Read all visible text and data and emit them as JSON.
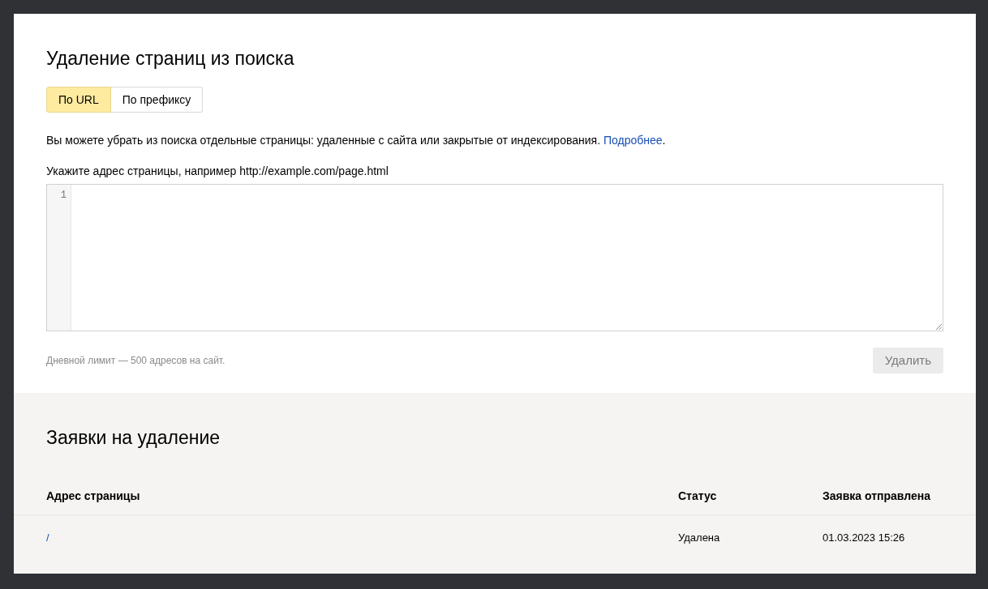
{
  "title": "Удаление страниц из поиска",
  "tabs": [
    {
      "label": "По URL",
      "selected": true
    },
    {
      "label": "По префиксу",
      "selected": false
    }
  ],
  "description": {
    "text": "Вы можете убрать из поиска отдельные страницы: удаленные с сайта или закрытые от индексирования.",
    "link": "Подробнее",
    "after": "."
  },
  "editor": {
    "label": "Укажите адрес страницы, например http://example.com/page.html",
    "line_numbers": [
      "1"
    ]
  },
  "limit_note": "Дневной лимит — 500 адресов на сайт.",
  "delete_button": {
    "label": "Удалить",
    "disabled": true
  },
  "requests": {
    "title": "Заявки на удаление",
    "columns": [
      "Адрес страницы",
      "Статус",
      "Заявка отправлена"
    ],
    "rows": [
      {
        "address": "/",
        "status": "Удалена",
        "sent": "01.03.2023 15:26"
      }
    ]
  }
}
